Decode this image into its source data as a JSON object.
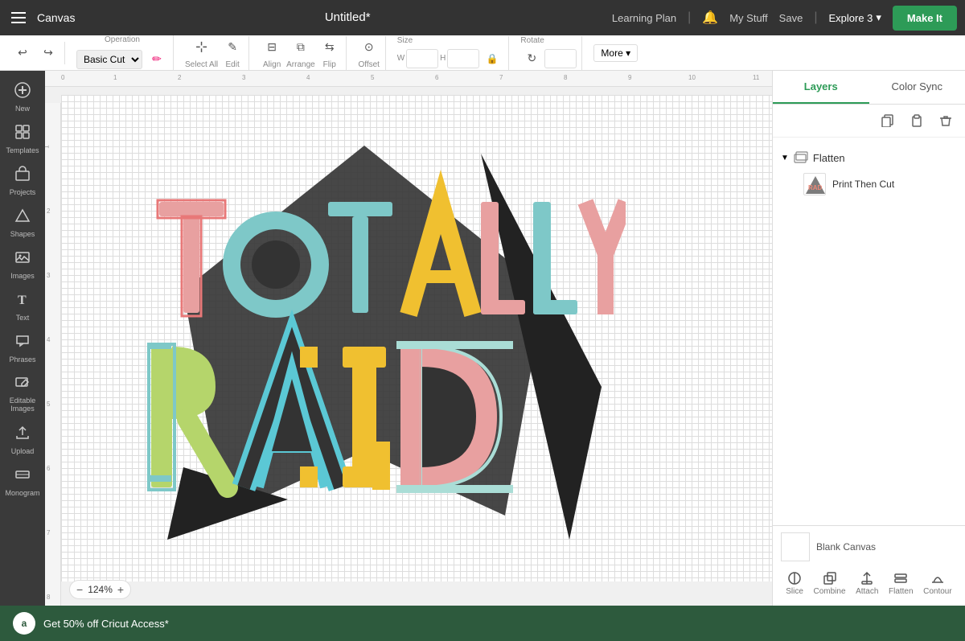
{
  "topbar": {
    "menu_label": "Canvas",
    "title": "Untitled*",
    "learning_plan": "Learning Plan",
    "bell": "🔔",
    "my_stuff": "My Stuff",
    "save": "Save",
    "separator": "|",
    "machine": "Explore 3",
    "make_it": "Make It"
  },
  "toolbar": {
    "operation_label": "Operation",
    "operation_value": "Basic Cut",
    "select_all": "Select All",
    "edit": "Edit",
    "align": "Align",
    "arrange": "Arrange",
    "flip": "Flip",
    "offset": "Offset",
    "size_label": "Size",
    "size_w": "W",
    "size_h": "H",
    "rotate": "Rotate",
    "more": "More ▾",
    "undo_icon": "↩",
    "redo_icon": "↪"
  },
  "sidebar": {
    "items": [
      {
        "label": "New",
        "icon": "+"
      },
      {
        "label": "Templates",
        "icon": "⊞"
      },
      {
        "label": "Projects",
        "icon": "📁"
      },
      {
        "label": "Shapes",
        "icon": "△"
      },
      {
        "label": "Images",
        "icon": "🖼"
      },
      {
        "label": "Text",
        "icon": "T"
      },
      {
        "label": "Phrases",
        "icon": "💬"
      },
      {
        "label": "Editable\nImages",
        "icon": "✏"
      },
      {
        "label": "Upload",
        "icon": "⬆"
      },
      {
        "label": "Monogram",
        "icon": "M"
      }
    ]
  },
  "right_panel": {
    "tabs": [
      {
        "label": "Layers",
        "active": true
      },
      {
        "label": "Color Sync",
        "active": false
      }
    ],
    "panel_tools": [
      "copy",
      "paste",
      "delete"
    ],
    "layer_group": {
      "label": "Flatten",
      "expanded": true,
      "items": [
        {
          "name": "Print Then Cut"
        }
      ]
    },
    "blank_canvas_label": "Blank Canvas",
    "bottom_tools": [
      "Slice",
      "Combine",
      "Attach",
      "Flatten",
      "Contour"
    ]
  },
  "zoom": {
    "level": "124%"
  },
  "promo": {
    "text": "Get 50% off Cricut Access*"
  },
  "ruler": {
    "marks": [
      "0",
      "1",
      "2",
      "3",
      "4",
      "5",
      "6",
      "7",
      "8",
      "9",
      "10",
      "11"
    ]
  }
}
